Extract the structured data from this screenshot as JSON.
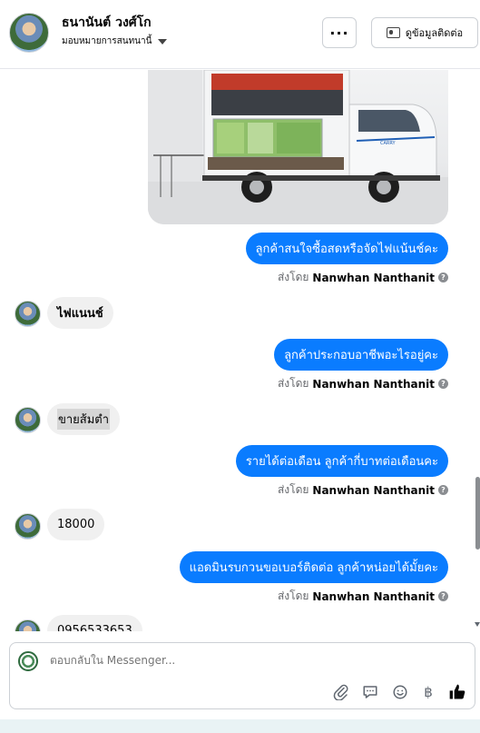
{
  "header": {
    "name": "ธนานันต์ วงศ์โก",
    "assignee": "มอบหมายการสนทนานี้",
    "more_label": "···",
    "contact_label": "ดูข้อมูลติดต่อ"
  },
  "messages": [
    {
      "type": "out",
      "text": "ลูกค้าสนใจซื้อสดหรือจัดไฟแน้นช์คะ"
    },
    {
      "type": "in",
      "text": "ไฟแนนช์"
    },
    {
      "type": "out",
      "text": "ลูกค้าประกอบอาชีพอะไรอยู่คะ"
    },
    {
      "type": "in",
      "text": "ขายส้มตำ"
    },
    {
      "type": "out",
      "text": "รายได้ต่อเดือน ลูกค้ากี่บาทต่อเดือนคะ"
    },
    {
      "type": "in",
      "text": "18000"
    },
    {
      "type": "out",
      "text": "แอดมินรบกวนขอเบอร์ติดต่อ ลูกค้าหน่อยได้มั้ยคะ"
    },
    {
      "type": "in",
      "text": "0956533653"
    }
  ],
  "sent_by": {
    "prefix": "ส่งโดย",
    "name": "Nanwhan Nanthanit",
    "info_icon": "?"
  },
  "photo": {
    "truck_brand": "CARRY"
  },
  "composer": {
    "placeholder": "ตอบกลับใน Messenger...",
    "icons": [
      "paperclip-icon",
      "saved-reply-icon",
      "emoji-icon",
      "baht-icon",
      "thumbs-up-icon"
    ]
  }
}
